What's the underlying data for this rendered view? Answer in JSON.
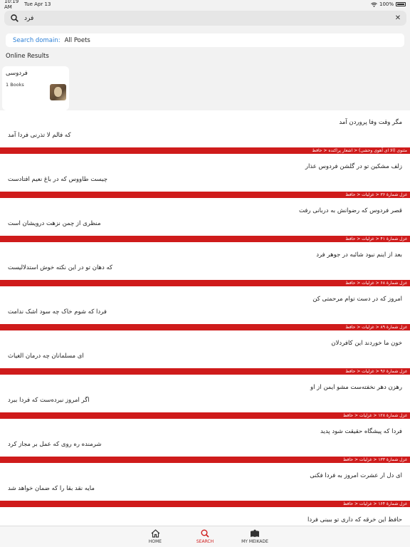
{
  "status": {
    "time": "10:19 AM",
    "date": "Tue Apr 13",
    "battery": "100%"
  },
  "search": {
    "query": "فرد"
  },
  "domain": {
    "label": "Search domain:",
    "value": "All Poets"
  },
  "online": {
    "title": "Online Results",
    "poet": {
      "name": "فردوسی",
      "books": "1 Books"
    }
  },
  "results": [
    {
      "line1": "مگر وقت وفا پروردن آمد",
      "line2": "که فالم لا تذرنی فردا آمد",
      "crumb": "مثنوی (الا ای آهوی وحشی)   <   اشعار پراکنده   <   حافظ"
    },
    {
      "line1": "زلف مشکین تو در گلشن فردوس عذار",
      "line2": "چیست طاووس که در باغ نعیم افتادست",
      "crumb": "غزل شمارهٔ ۳۶   <   غزلیات   <   حافظ"
    },
    {
      "line1": "قصر فردوس که رضوانش به دربانی رفت",
      "line2": "منظری از چمن نزهت درویشان است",
      "crumb": "غزل شمارهٔ ۴۱   <   غزلیات   <   حافظ"
    },
    {
      "line1": "بعد از اینم نبود شائبه در جوهر فرد",
      "line2": "که دهان تو در این نکته خوش استدلالیست",
      "crumb": "غزل شمارهٔ ۶۸   <   غزلیات   <   حافظ"
    },
    {
      "line1": "امروز که در دست توام مرحمتی کن",
      "line2": "فردا که شوم خاک چه سود اشک ندامت",
      "crumb": "غزل شمارهٔ ۸۹   <   غزلیات   <   حافظ"
    },
    {
      "line1": "خون ما خوردند این کافردلان",
      "line2": "ای مسلمانان چه درمان الغیاث",
      "crumb": "غزل شمارهٔ ۹۶   <   غزلیات   <   حافظ"
    },
    {
      "line1": "رهزن دهر نخفته‌ست مشو ایمن از او",
      "line2": "اگر امروز نبرده‌ست که فردا ببرد",
      "crumb": "غزل شمارهٔ ۱۲۸   <   غزلیات   <   حافظ"
    },
    {
      "line1": "فردا که پیشگاه حقیقت شود پدید",
      "line2": "شرمنده ره روی که عمل بر مجاز کرد",
      "crumb": "غزل شمارهٔ ۱۳۳   <   غزلیات   <   حافظ"
    },
    {
      "line1": "ای دل ار عشرت امروز به فردا فکنی",
      "line2": "مایه نقد بقا را که ضمان خواهد شد",
      "crumb": "غزل شمارهٔ ۱۶۴   <   غزلیات   <   حافظ"
    },
    {
      "line1": "حافظ این خرقه که داری تو ببینی فردا",
      "line2": "",
      "crumb": ""
    }
  ],
  "tabs": [
    {
      "label": "HOME",
      "icon": "home-icon"
    },
    {
      "label": "SEARCH",
      "icon": "search-icon"
    },
    {
      "label": "MY MEIKADE",
      "icon": "book-icon"
    }
  ],
  "colors": {
    "accent": "#cf1b1b",
    "link": "#2b7fd6",
    "background": "#f2f2f2"
  }
}
